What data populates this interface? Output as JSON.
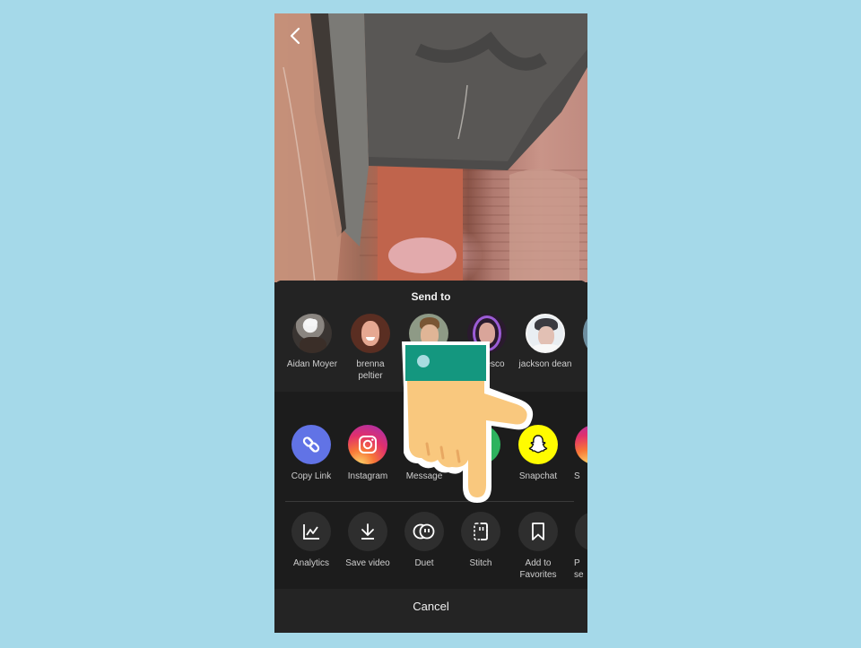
{
  "header": {
    "back_icon": "chevron-left-icon"
  },
  "share_sheet": {
    "title": "Send to",
    "contacts": [
      {
        "name": "Aidan Moyer",
        "avatar": "avatar-photo"
      },
      {
        "name": "brenna\npeltier",
        "avatar": "avatar-photo"
      },
      {
        "name": "",
        "avatar": "avatar-photo"
      },
      {
        "name": "esco",
        "avatar": "avatar-photo"
      },
      {
        "name": "jackson dean",
        "avatar": "avatar-photo"
      }
    ],
    "apps": [
      {
        "label": "Copy Link",
        "icon": "link-icon",
        "color": "#6173e6"
      },
      {
        "label": "Instagram",
        "icon": "instagram-icon",
        "color": "#d6307a"
      },
      {
        "label": "Message",
        "icon": "message-icon",
        "color": "#c0245a"
      },
      {
        "label": "",
        "icon": "whatsapp-icon",
        "color": "#2eb35f"
      },
      {
        "label": "Snapchat",
        "icon": "snapchat-icon",
        "color": "#fffc00"
      },
      {
        "label": "S",
        "icon": "instagram-stories-icon",
        "color": "#b03fc4"
      }
    ],
    "actions": [
      {
        "label": "Analytics",
        "icon": "analytics-icon"
      },
      {
        "label": "Save video",
        "icon": "download-icon"
      },
      {
        "label": "Duet",
        "icon": "duet-icon"
      },
      {
        "label": "Stitch",
        "icon": "stitch-icon"
      },
      {
        "label": "Add to\nFavorites",
        "icon": "bookmark-icon"
      },
      {
        "label": "P\nse",
        "icon": "more-icon"
      }
    ],
    "cancel_label": "Cancel"
  },
  "overlay": {
    "icon": "pointing-hand-icon",
    "cuff_color": "#14977f",
    "skin_color": "#f9c87e"
  },
  "colors": {
    "page_background": "#a5d9e9",
    "sheet_background": "#1f1f1f"
  }
}
